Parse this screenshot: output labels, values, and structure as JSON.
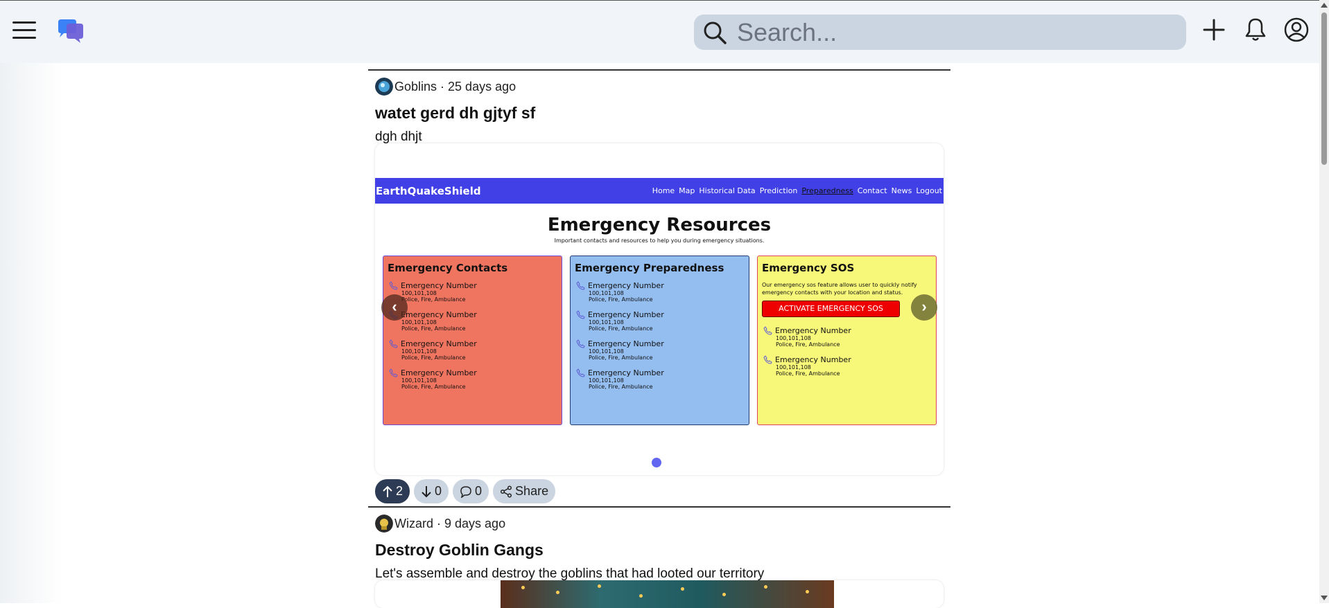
{
  "header": {
    "search_placeholder": "Search..."
  },
  "posts": [
    {
      "community": "Goblins",
      "time": "25 days ago",
      "title": "watet gerd dh gjtyf sf",
      "body": "dgh dhjt",
      "upvotes": "2",
      "downvotes": "0",
      "comments": "0",
      "share_label": "Share",
      "screenshot": {
        "brand": "EarthQuakeShield",
        "nav": [
          "Home",
          "Map",
          "Historical Data",
          "Prediction",
          "Preparedness",
          "Contact",
          "News",
          "Logout"
        ],
        "title": "Emergency Resources",
        "subtitle": "Important contacts and resources to help you during emergency situations.",
        "cards": [
          {
            "title": "Emergency Contacts",
            "color": "#f07560",
            "entries": [
              {
                "title": "Emergency Number",
                "number": "100,101,108",
                "desc": "Police, Fire, Ambulance"
              },
              {
                "title": "Emergency Number",
                "number": "100,101,108",
                "desc": "Police, Fire, Ambulance"
              },
              {
                "title": "Emergency Number",
                "number": "100,101,108",
                "desc": "Police, Fire, Ambulance"
              },
              {
                "title": "Emergency Number",
                "number": "100,101,108",
                "desc": "Police, Fire, Ambulance"
              }
            ]
          },
          {
            "title": "Emergency Preparedness",
            "color": "#94bdf0",
            "entries": [
              {
                "title": "Emergency Number",
                "number": "100,101,108",
                "desc": "Police, Fire, Ambulance"
              },
              {
                "title": "Emergency Number",
                "number": "100,101,108",
                "desc": "Police, Fire, Ambulance"
              },
              {
                "title": "Emergency Number",
                "number": "100,101,108",
                "desc": "Police, Fire, Ambulance"
              },
              {
                "title": "Emergency Number",
                "number": "100,101,108",
                "desc": "Police, Fire, Ambulance"
              }
            ]
          },
          {
            "title": "Emergency SOS",
            "color": "#f7f77a",
            "sos_text": "Our emergency sos feature allows user to quickly notify emergency contacts with your location and status.",
            "sos_button": "ACTIVATE EMERGENCY SOS",
            "entries": [
              {
                "title": "Emergency Number",
                "number": "100,101,108",
                "desc": "Police, Fire, Ambulance"
              },
              {
                "title": "Emergency Number",
                "number": "100,101,108",
                "desc": "Police, Fire, Ambulance"
              }
            ]
          }
        ]
      }
    },
    {
      "community": "Wizard",
      "time": "9 days ago",
      "title": "Destroy Goblin Gangs",
      "body": "Let's assemble and destroy the goblins that had looted our territory"
    }
  ],
  "icons": {
    "menu": "hamburger-icon",
    "logo": "chat-bubbles-logo",
    "search": "search-icon",
    "create": "plus-icon",
    "notifications": "bell-icon",
    "profile": "user-circle-icon"
  },
  "colors": {
    "header_bg": "#f1f5f9",
    "search_bg": "#cbd5e1",
    "upvote_active": "#2d3b55",
    "dot": "#6366f1"
  }
}
